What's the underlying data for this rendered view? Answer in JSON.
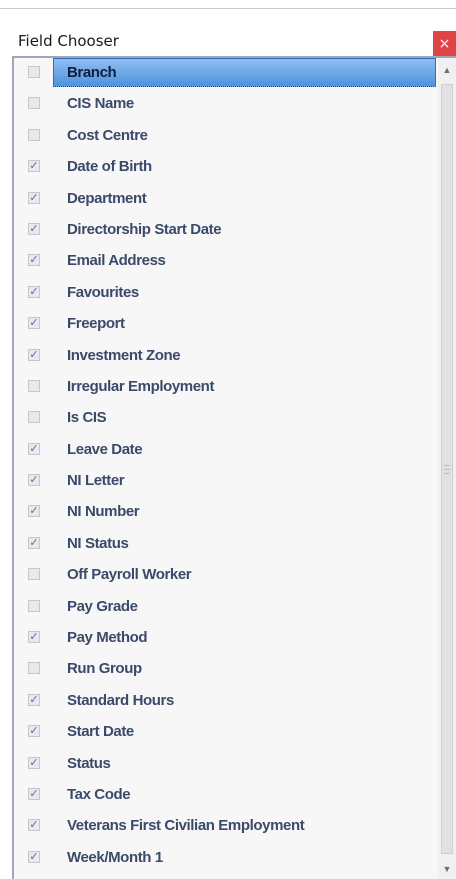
{
  "window": {
    "title": "Field Chooser",
    "close_glyph": "×"
  },
  "fields": [
    {
      "label": "Branch",
      "checked": false,
      "selected": true
    },
    {
      "label": "CIS Name",
      "checked": false
    },
    {
      "label": "Cost Centre",
      "checked": false
    },
    {
      "label": "Date of Birth",
      "checked": true
    },
    {
      "label": "Department",
      "checked": true
    },
    {
      "label": "Directorship Start Date",
      "checked": true
    },
    {
      "label": "Email Address",
      "checked": true
    },
    {
      "label": "Favourites",
      "checked": true
    },
    {
      "label": "Freeport",
      "checked": true
    },
    {
      "label": "Investment Zone",
      "checked": true
    },
    {
      "label": "Irregular Employment",
      "checked": false
    },
    {
      "label": "Is CIS",
      "checked": false
    },
    {
      "label": "Leave Date",
      "checked": true
    },
    {
      "label": "NI Letter",
      "checked": true
    },
    {
      "label": "NI Number",
      "checked": true
    },
    {
      "label": "NI Status",
      "checked": true
    },
    {
      "label": "Off Payroll Worker",
      "checked": false
    },
    {
      "label": "Pay Grade",
      "checked": false
    },
    {
      "label": "Pay Method",
      "checked": true
    },
    {
      "label": "Run Group",
      "checked": false
    },
    {
      "label": "Standard Hours",
      "checked": true
    },
    {
      "label": "Start Date",
      "checked": true
    },
    {
      "label": "Status",
      "checked": true
    },
    {
      "label": "Tax Code",
      "checked": true
    },
    {
      "label": "Veterans First Civilian Employment",
      "checked": true
    },
    {
      "label": "Week/Month 1",
      "checked": true
    }
  ],
  "scrollbar": {
    "up_icon": "scroll-up-arrow-icon",
    "down_icon": "scroll-down-arrow-icon",
    "grip_icon": "scroll-grip-icon"
  },
  "colors": {
    "selection": "#4e93dd",
    "label": "#3b4a6a",
    "close": "#e04343"
  }
}
